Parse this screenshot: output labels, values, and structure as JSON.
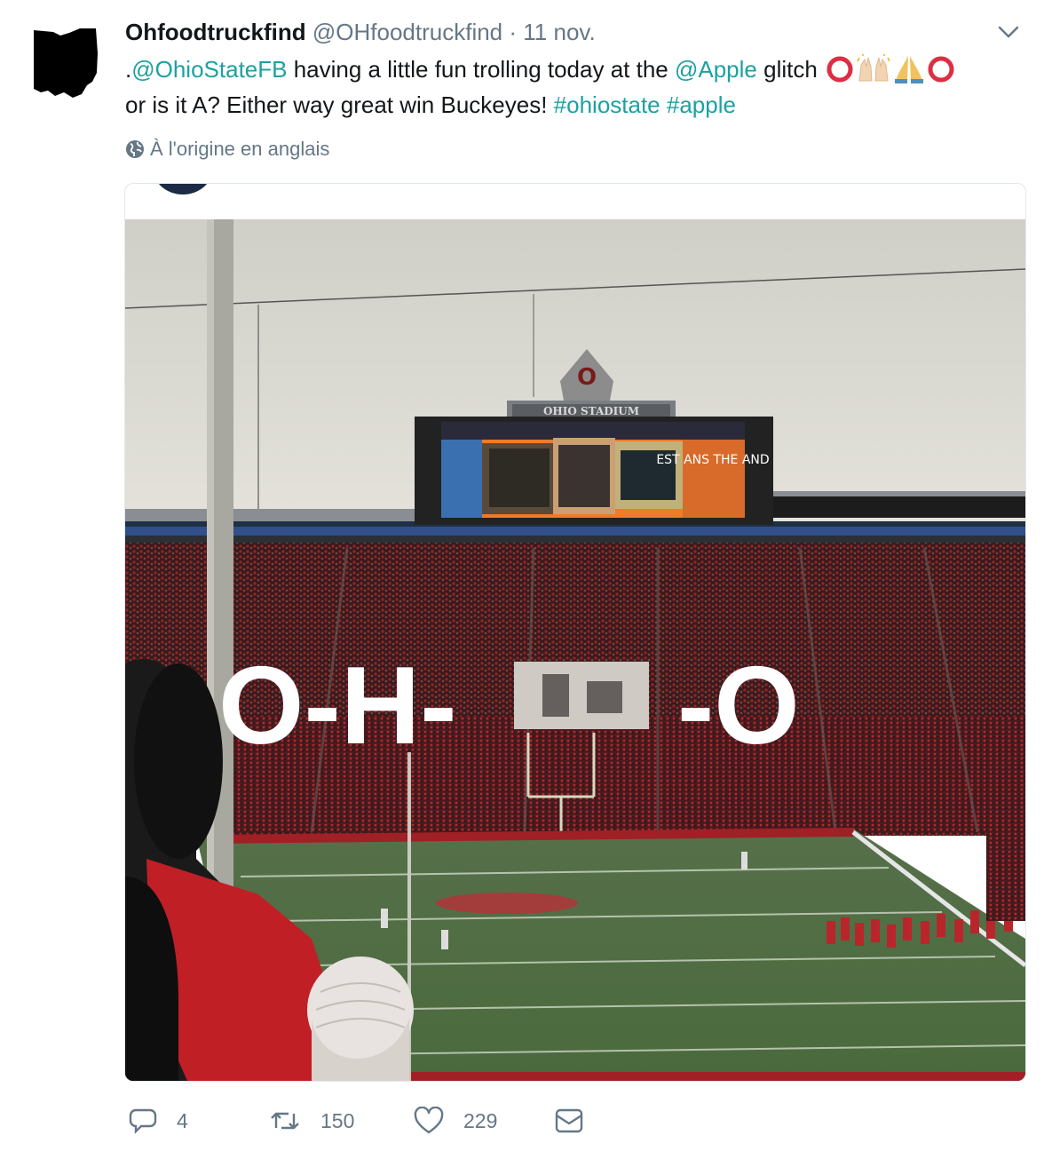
{
  "author": {
    "display_name": "Ohfoodtruckfind",
    "handle": "@OHfoodtruckfind",
    "separator": "·",
    "date": "11 nov."
  },
  "tweet": {
    "lead": ".",
    "mention_team": "@OhioStateFB",
    "text_1": " having a little fun trolling today at the ",
    "mention_brand": "@Apple",
    "text_2": " glitch ",
    "text_3": "or is it A? Either way great win Buckeyes! ",
    "hashtag_1": "#ohiostate",
    "hashtag_2": "#apple"
  },
  "translation_note": "À l'origine en anglais",
  "photo": {
    "stadium_sign": "OHIO STADIUM",
    "video_board_text": "EST ANS THE AND",
    "overlay_left": "O-H-",
    "overlay_right": "-O"
  },
  "actions": {
    "replies": "4",
    "retweets": "150",
    "likes": "229"
  },
  "colors": {
    "link": "#1da1a1",
    "secondary_text": "#657786",
    "scarlet": "#bb0000"
  },
  "icons": [
    "ohio-state-shape-avatar",
    "chevron-down-icon",
    "globe-icon",
    "reply-icon",
    "retweet-icon",
    "like-icon",
    "direct-message-icon"
  ]
}
